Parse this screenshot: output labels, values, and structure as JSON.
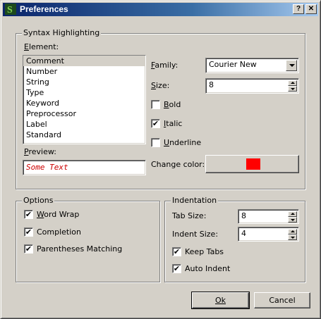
{
  "window": {
    "title": "Preferences",
    "help_label": "?",
    "close_label": "✕"
  },
  "syntax": {
    "group_label": "Syntax Highlighting",
    "element_label": "Element:",
    "elements": [
      "Comment",
      "Number",
      "String",
      "Type",
      "Keyword",
      "Preprocessor",
      "Label",
      "Standard"
    ],
    "selected_element": "Comment",
    "preview_label": "Preview:",
    "preview_text": "Some Text",
    "preview_color": "#cc0000",
    "family_label": "Family:",
    "family_value": "Courier New",
    "size_label": "Size:",
    "size_value": "8",
    "bold_label": "Bold",
    "bold_checked": false,
    "italic_label": "Italic",
    "italic_checked": true,
    "underline_label": "Underline",
    "underline_checked": false,
    "change_color_label": "Change color:",
    "color_swatch": "#ff0000"
  },
  "options": {
    "group_label": "Options",
    "word_wrap_label": "Word Wrap",
    "word_wrap_checked": true,
    "completion_label": "Completion",
    "completion_checked": true,
    "parentheses_label": "Parentheses Matching",
    "parentheses_checked": true
  },
  "indentation": {
    "group_label": "Indentation",
    "tab_size_label": "Tab Size:",
    "tab_size_value": "8",
    "indent_size_label": "Indent Size:",
    "indent_size_value": "4",
    "keep_tabs_label": "Keep Tabs",
    "keep_tabs_checked": true,
    "auto_indent_label": "Auto Indent",
    "auto_indent_checked": true
  },
  "footer": {
    "ok_label": "Ok",
    "cancel_label": "Cancel"
  },
  "icons": {
    "app_icon": "app-s-icon",
    "check_mark": "✔"
  }
}
